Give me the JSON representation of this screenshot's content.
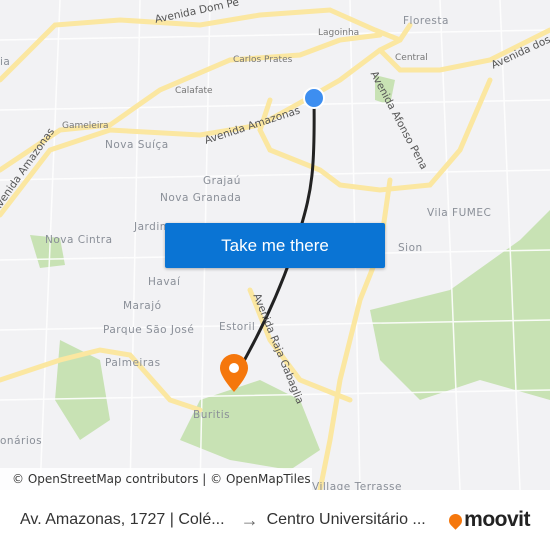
{
  "map": {
    "labels": {
      "av_dom_pedro": "Avenida Dom Pe",
      "floresta": "Floresta",
      "lagoinha": "Lagoinha",
      "carlos_prates": "Carlos Prates",
      "central": "Central",
      "av_dos": "Avenida dos",
      "calafate": "Calafate",
      "av_afonso_pena": "Avenida Afonso Pena",
      "gameleira": "Gameleira",
      "av_amazonas": "Avenida Amazonas",
      "av_amazonas_2": "Avenida Amazonas",
      "nova_suica": "Nova Suíça",
      "grajau": "Grajaú",
      "nova_granada": "Nova Granada",
      "vila_fumec": "Vila FUMEC",
      "jardim": "Jardim",
      "nova_cintra": "Nova Cintra",
      "sion": "Sion",
      "havai": "Havaí",
      "marajo": "Marajó",
      "parque_sao_jose": "Parque São José",
      "estoril": "Estoril",
      "av_raja_gabaglia": "Avenida Raja Gabaglia",
      "palmeiras": "Palmeiras",
      "buritis": "Buritis",
      "onarios": "onários",
      "village_terrasse": "Village Terrasse",
      "ia": "ia"
    },
    "origin_marker_icon": "blue-dot",
    "destination_marker_icon": "orange-map-pin",
    "colors": {
      "route": "#222222",
      "origin": "#3d8ef0",
      "destination": "#f5770c",
      "cta": "#0a74d4",
      "road": "#fbe7a1",
      "park": "#c8e2b4"
    }
  },
  "cta_label": "Take me there",
  "attribution": {
    "osm": "© OpenStreetMap contributors",
    "sep": " | ",
    "omt": "© OpenMapTiles"
  },
  "footer": {
    "from": "Av. Amazonas, 1727 | Colé...",
    "arrow": "→",
    "to": "Centro Universitário ...",
    "brand": "moovit"
  }
}
